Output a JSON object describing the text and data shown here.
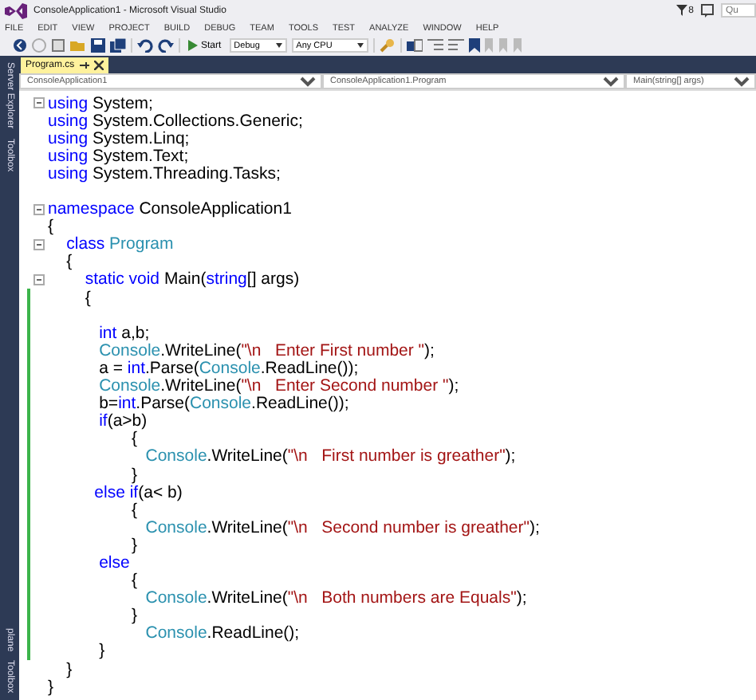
{
  "window": {
    "title": "ConsoleApplication1 - Microsoft Visual Studio",
    "notification_count": "8",
    "quick_launch": {
      "placeholder": "Qu"
    }
  },
  "menu": [
    "FILE",
    "EDIT",
    "VIEW",
    "PROJECT",
    "BUILD",
    "DEBUG",
    "TEAM",
    "TOOLS",
    "TEST",
    "ANALYZE",
    "WINDOW",
    "HELP"
  ],
  "toolbar": {
    "start": "Start",
    "configuration": "Debug",
    "platform": "Any CPU"
  },
  "side_tabs_top": [
    "Server Explorer",
    "Toolbox"
  ],
  "side_tabs_bottom": [
    "plane",
    "Toolbox"
  ],
  "tabs": [
    {
      "label": "Program.cs",
      "selected": true
    }
  ],
  "nav_bar": [
    "ConsoleApplication1",
    "ConsoleApplication1.Program",
    "Main(string[] args)"
  ],
  "code": [
    {
      "fold": true,
      "changed": false,
      "tokens": [
        {
          "kind": "kw",
          "text": "using"
        },
        {
          "kind": "plain",
          "text": " System;"
        }
      ]
    },
    {
      "fold": false,
      "changed": false,
      "tokens": [
        {
          "kind": "kw",
          "text": "using"
        },
        {
          "kind": "plain",
          "text": " System.Collections.Generic;"
        }
      ]
    },
    {
      "fold": false,
      "changed": false,
      "tokens": [
        {
          "kind": "kw",
          "text": "using"
        },
        {
          "kind": "plain",
          "text": " System.Linq;"
        }
      ]
    },
    {
      "fold": false,
      "changed": false,
      "tokens": [
        {
          "kind": "kw",
          "text": "using"
        },
        {
          "kind": "plain",
          "text": " System.Text;"
        }
      ]
    },
    {
      "fold": false,
      "changed": false,
      "tokens": [
        {
          "kind": "kw",
          "text": "using"
        },
        {
          "kind": "plain",
          "text": " System.Threading.Tasks;"
        }
      ]
    },
    {
      "fold": false,
      "changed": false
    },
    {
      "fold": true,
      "changed": false,
      "tokens": [
        {
          "kind": "kw",
          "text": "namespace"
        },
        {
          "kind": "plain",
          "text": " ConsoleApplication1"
        }
      ]
    },
    {
      "fold": false,
      "changed": false,
      "tokens": [
        {
          "kind": "plain",
          "text": "{"
        }
      ]
    },
    {
      "fold": true,
      "changed": false,
      "tokens": [
        {
          "kind": "kw",
          "text": "    class"
        },
        {
          "kind": "type",
          "text": " Program"
        }
      ]
    },
    {
      "fold": false,
      "changed": false,
      "tokens": [
        {
          "kind": "plain",
          "text": "    {"
        }
      ]
    },
    {
      "fold": true,
      "changed": false,
      "tokens": [
        {
          "kind": "kw",
          "text": "        static void"
        },
        {
          "kind": "plain",
          "text": " Main("
        },
        {
          "kind": "kw",
          "text": "string"
        },
        {
          "kind": "plain",
          "text": "[] args)"
        }
      ]
    },
    {
      "fold": false,
      "changed": true,
      "tokens": [
        {
          "kind": "plain",
          "text": "        {"
        }
      ]
    },
    {
      "fold": false,
      "changed": true
    },
    {
      "fold": false,
      "changed": true,
      "tokens": [
        {
          "kind": "kw",
          "text": "           int"
        },
        {
          "kind": "plain",
          "text": " a,b;"
        }
      ]
    },
    {
      "fold": false,
      "changed": true,
      "tokens": [
        {
          "kind": "type",
          "text": "           Console"
        },
        {
          "kind": "plain",
          "text": ".WriteLine("
        },
        {
          "kind": "str",
          "text": "\"\\n   Enter First number \""
        },
        {
          "kind": "plain",
          "text": ");"
        }
      ]
    },
    {
      "fold": false,
      "changed": true,
      "tokens": [
        {
          "kind": "plain",
          "text": "           a = "
        },
        {
          "kind": "kw",
          "text": "int"
        },
        {
          "kind": "plain",
          "text": ".Parse("
        },
        {
          "kind": "type",
          "text": "Console"
        },
        {
          "kind": "plain",
          "text": ".ReadLine());"
        }
      ]
    },
    {
      "fold": false,
      "changed": true,
      "tokens": [
        {
          "kind": "type",
          "text": "           Console"
        },
        {
          "kind": "plain",
          "text": ".WriteLine("
        },
        {
          "kind": "str",
          "text": "\"\\n   Enter Second number \""
        },
        {
          "kind": "plain",
          "text": ");"
        }
      ]
    },
    {
      "fold": false,
      "changed": true,
      "tokens": [
        {
          "kind": "plain",
          "text": "           b="
        },
        {
          "kind": "kw",
          "text": "int"
        },
        {
          "kind": "plain",
          "text": ".Parse("
        },
        {
          "kind": "type",
          "text": "Console"
        },
        {
          "kind": "plain",
          "text": ".ReadLine());"
        }
      ]
    },
    {
      "fold": false,
      "changed": true,
      "tokens": [
        {
          "kind": "kw",
          "text": "           if"
        },
        {
          "kind": "plain",
          "text": "(a>b)"
        }
      ]
    },
    {
      "fold": false,
      "changed": true,
      "tokens": [
        {
          "kind": "plain",
          "text": "                  {"
        }
      ]
    },
    {
      "fold": false,
      "changed": true,
      "tokens": [
        {
          "kind": "type",
          "text": "                     Console"
        },
        {
          "kind": "plain",
          "text": ".WriteLine("
        },
        {
          "kind": "str",
          "text": "\"\\n   First number is greather\""
        },
        {
          "kind": "plain",
          "text": ");"
        }
      ]
    },
    {
      "fold": false,
      "changed": true,
      "tokens": [
        {
          "kind": "plain",
          "text": "                  }"
        }
      ]
    },
    {
      "fold": false,
      "changed": true,
      "tokens": [
        {
          "kind": "kw",
          "text": "          else if"
        },
        {
          "kind": "plain",
          "text": "(a< b)"
        }
      ]
    },
    {
      "fold": false,
      "changed": true,
      "tokens": [
        {
          "kind": "plain",
          "text": "                  {"
        }
      ]
    },
    {
      "fold": false,
      "changed": true,
      "tokens": [
        {
          "kind": "type",
          "text": "                     Console"
        },
        {
          "kind": "plain",
          "text": ".WriteLine("
        },
        {
          "kind": "str",
          "text": "\"\\n   Second number is greather\""
        },
        {
          "kind": "plain",
          "text": ");"
        }
      ]
    },
    {
      "fold": false,
      "changed": true,
      "tokens": [
        {
          "kind": "plain",
          "text": "                  }"
        }
      ]
    },
    {
      "fold": false,
      "changed": true,
      "tokens": [
        {
          "kind": "kw",
          "text": "           else"
        }
      ]
    },
    {
      "fold": false,
      "changed": true,
      "tokens": [
        {
          "kind": "plain",
          "text": "                  {"
        }
      ]
    },
    {
      "fold": false,
      "changed": true,
      "tokens": [
        {
          "kind": "type",
          "text": "                     Console"
        },
        {
          "kind": "plain",
          "text": ".WriteLine("
        },
        {
          "kind": "str",
          "text": "\"\\n   Both numbers are Equals\""
        },
        {
          "kind": "plain",
          "text": ");"
        }
      ]
    },
    {
      "fold": false,
      "changed": true,
      "tokens": [
        {
          "kind": "plain",
          "text": "                  }"
        }
      ]
    },
    {
      "fold": false,
      "changed": true,
      "tokens": [
        {
          "kind": "type",
          "text": "                     Console"
        },
        {
          "kind": "plain",
          "text": ".ReadLine();"
        }
      ]
    },
    {
      "fold": false,
      "changed": true,
      "tokens": [
        {
          "kind": "plain",
          "text": "           }"
        }
      ]
    },
    {
      "fold": false,
      "changed": false,
      "tokens": [
        {
          "kind": "plain",
          "text": "    }"
        }
      ]
    },
    {
      "fold": false,
      "changed": false,
      "tokens": [
        {
          "kind": "plain",
          "text": "}"
        }
      ]
    }
  ]
}
